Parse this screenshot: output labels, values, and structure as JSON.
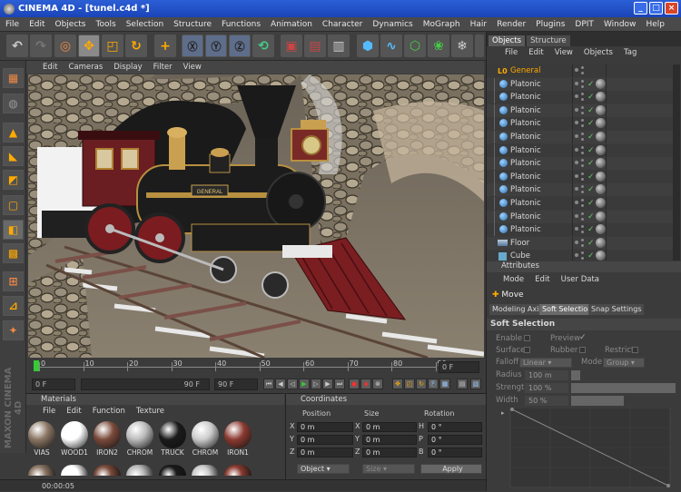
{
  "window": {
    "title": "CINEMA 4D - [tunel.c4d *]"
  },
  "menubar": [
    "File",
    "Edit",
    "Objects",
    "Tools",
    "Selection",
    "Structure",
    "Functions",
    "Animation",
    "Character",
    "Dynamics",
    "MoGraph",
    "Hair",
    "Render",
    "Plugins",
    "DPIT",
    "Window",
    "Help"
  ],
  "viewport": {
    "menu": [
      "Edit",
      "Cameras",
      "Display",
      "Filter",
      "View"
    ],
    "sign_text": "GENERAL"
  },
  "timeline": {
    "ticks": [
      "0",
      "10",
      "20",
      "30",
      "40",
      "50",
      "60",
      "70",
      "80",
      "90"
    ],
    "frame_field": "0 F",
    "start_field": "0 F",
    "end_field": "90 F",
    "end_field2": "90 F"
  },
  "materials": {
    "title": "Materials",
    "menu": [
      "File",
      "Edit",
      "Function",
      "Texture"
    ],
    "items": [
      {
        "label": "VIAS",
        "color": "#8a7563"
      },
      {
        "label": "WOOD1",
        "color": "#ffffff"
      },
      {
        "label": "IRON2",
        "color": "#7a4a3a"
      },
      {
        "label": "CHROM",
        "color": "#bbbbbb"
      },
      {
        "label": "TRUCK",
        "color": "#1a1a1a"
      },
      {
        "label": "CHROM",
        "color": "#cccccc"
      },
      {
        "label": "IRON1",
        "color": "#8a3a30"
      }
    ]
  },
  "coordinates": {
    "title": "Coordinates",
    "headers": [
      "Position",
      "Size",
      "Rotation"
    ],
    "rows": [
      {
        "axis": "X",
        "pos": "0 m",
        "saxis": "X",
        "size": "0 m",
        "raxis": "H",
        "rot": "0 °"
      },
      {
        "axis": "Y",
        "pos": "0 m",
        "saxis": "Y",
        "size": "0 m",
        "raxis": "P",
        "rot": "0 °"
      },
      {
        "axis": "Z",
        "pos": "0 m",
        "saxis": "Z",
        "size": "0 m",
        "raxis": "B",
        "rot": "0 °"
      }
    ],
    "mode": "Object",
    "size_mode": "Size",
    "apply": "Apply"
  },
  "objects": {
    "tabs": [
      "Objects",
      "Structure"
    ],
    "menu": [
      "File",
      "Edit",
      "View",
      "Objects",
      "Tag"
    ],
    "items": [
      {
        "name": "General",
        "type": "null"
      },
      {
        "name": "Platonic"
      },
      {
        "name": "Platonic"
      },
      {
        "name": "Platonic"
      },
      {
        "name": "Platonic"
      },
      {
        "name": "Platonic"
      },
      {
        "name": "Platonic"
      },
      {
        "name": "Platonic"
      },
      {
        "name": "Platonic"
      },
      {
        "name": "Platonic"
      },
      {
        "name": "Platonic"
      },
      {
        "name": "Platonic"
      },
      {
        "name": "Platonic"
      },
      {
        "name": "Floor",
        "type": "floor"
      },
      {
        "name": "Cube",
        "type": "cube"
      }
    ]
  },
  "attributes": {
    "title": "Attributes",
    "menu": [
      "Mode",
      "Edit",
      "User Data"
    ],
    "tool": "Move",
    "subtabs": [
      "Modeling Axis",
      "Soft Selection",
      "Snap Settings"
    ],
    "section": "Soft Selection",
    "enable": "Enable",
    "preview": "Preview",
    "surface": "Surface",
    "rubber": "Rubber",
    "restrict": "Restrict",
    "falloff": "Falloff",
    "falloff_value": "Linear",
    "mode": "Mode",
    "mode_value": "Group",
    "radius": "Radius",
    "radius_value": "100 m",
    "strength": "Strength",
    "strength_value": "100 %",
    "width": "Width",
    "width_value": "50 %"
  },
  "status": {
    "time": "00:00:05"
  },
  "brand": "MAXON CINEMA 4D"
}
